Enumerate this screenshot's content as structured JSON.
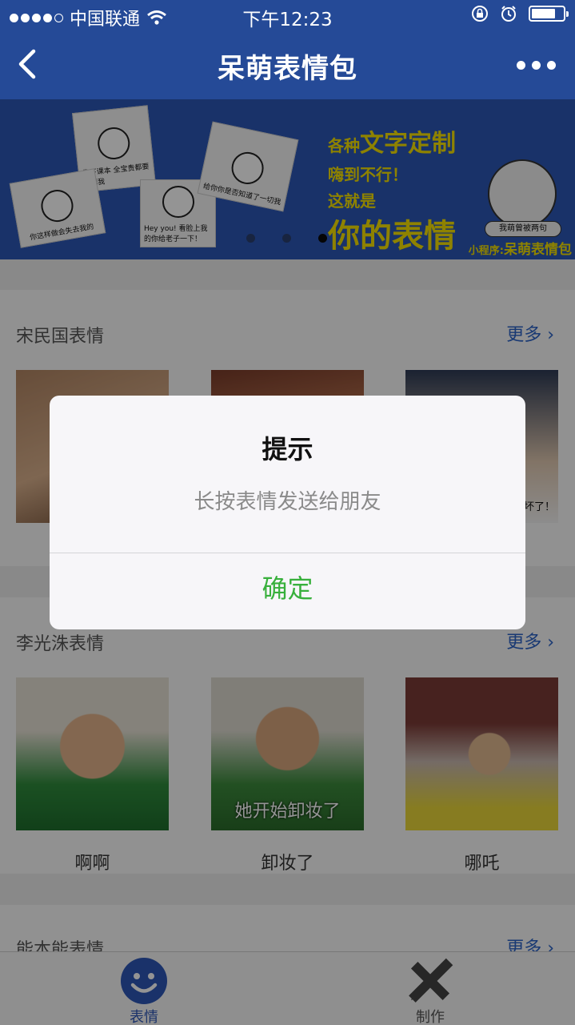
{
  "status_bar": {
    "carrier": "中国联通",
    "time": "下午12:23",
    "signal_icon": "signal-dots-icon",
    "wifi_icon": "wifi-icon",
    "rotation_lock_icon": "rotation-lock-icon",
    "alarm_icon": "alarm-icon",
    "battery_level": 0.75
  },
  "nav": {
    "title": "呆萌表情包",
    "back_icon": "chevron-left-icon",
    "more_icon": "more-dots-icon"
  },
  "banner": {
    "card_texts": [
      "像下课本 全宝贵都要用掉我",
      "你这样做会失去我的",
      "Hey you! 看脸上我的你给老子一下！",
      "给你你是否知道了一切我"
    ],
    "promo_line1_prefix": "各种",
    "promo_line1_highlight": "文字定制",
    "promo_line2": "嗨到不行！",
    "promo_line3": "这就是",
    "promo_line4": "你的表情",
    "mascot_tag": "我萌曾被两句",
    "mini_program_prefix": "小程序:",
    "mini_program_name": "呆萌表情包",
    "indicator_count": 3,
    "active_indicator": 3
  },
  "sections": [
    {
      "title": "宋民国表情",
      "more": "更多 ›",
      "items": [
        {
          "label": "",
          "caption": ""
        },
        {
          "label": "",
          "caption": ""
        },
        {
          "label": "",
          "caption": "的帅气！ 坏了！"
        }
      ]
    },
    {
      "title": "李光洙表情",
      "more": "更多 ›",
      "items": [
        {
          "label": "啊啊",
          "caption": ""
        },
        {
          "label": "卸妆了",
          "caption": "她开始卸妆了"
        },
        {
          "label": "哪吒",
          "caption": ""
        }
      ]
    },
    {
      "title": "能本能表情",
      "more": "更多 ›"
    }
  ],
  "dialog": {
    "title": "提示",
    "message": "长按表情发送给朋友",
    "confirm": "确定",
    "confirm_color": "#38b03c"
  },
  "tabbar": {
    "tabs": [
      {
        "label": "表情",
        "icon": "smiley-icon",
        "active": true
      },
      {
        "label": "制作",
        "icon": "pencil-ruler-icon",
        "active": false
      }
    ],
    "active_color": "#2d57b7"
  },
  "colors": {
    "nav_bg": "#254a97",
    "link": "#2b63c7",
    "promo_yellow": "#f4e100"
  }
}
